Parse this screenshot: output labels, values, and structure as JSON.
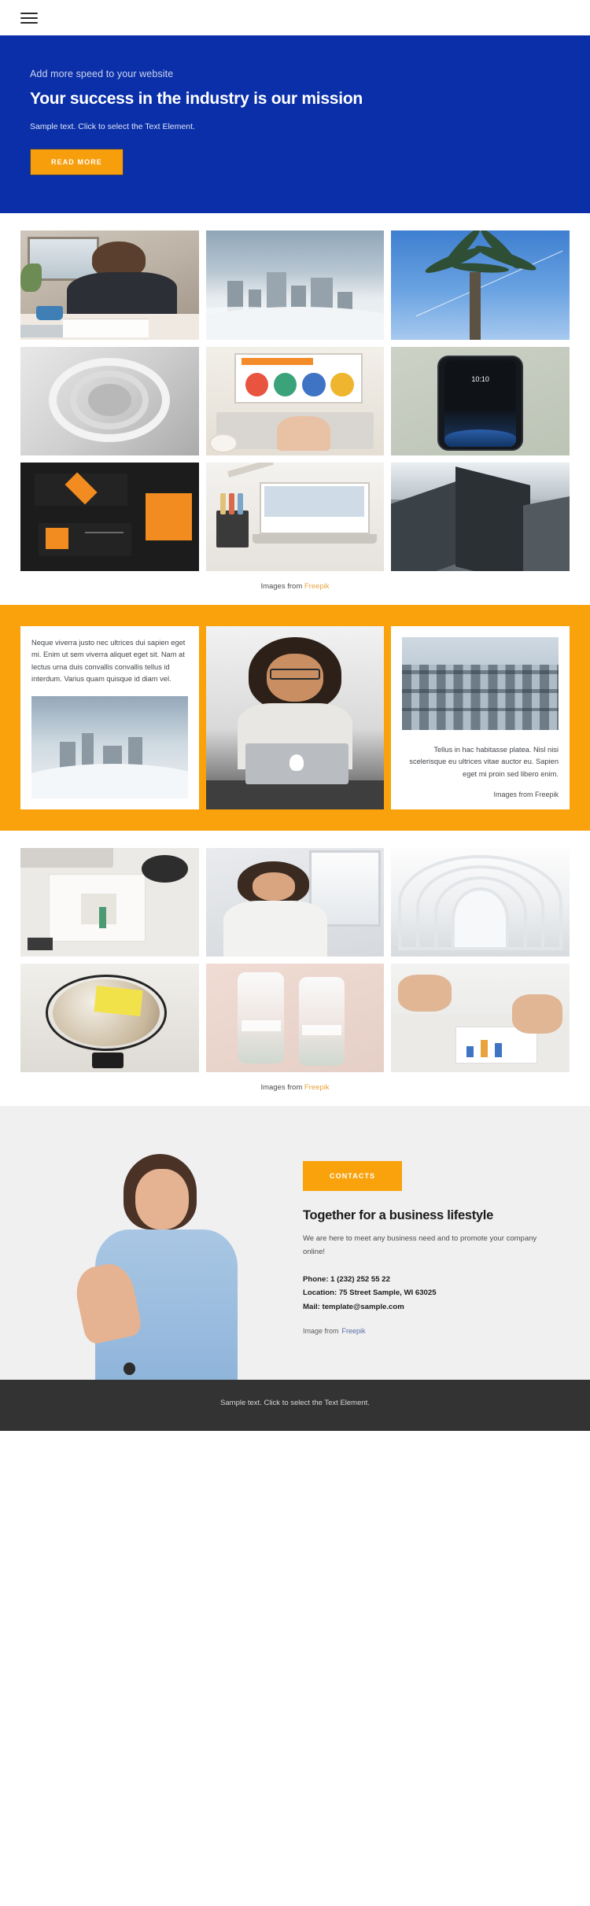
{
  "header": {
    "menu_icon": "hamburger-menu-icon"
  },
  "hero": {
    "eyebrow": "Add more speed to your website",
    "title": "Your success in the industry is our mission",
    "subtitle": "Sample text. Click to select the Text Element.",
    "cta_label": "READ MORE",
    "bg_color": "#0a2fa8",
    "cta_color": "#f79e0c"
  },
  "gallery_top": {
    "caption_prefix": "Images from ",
    "caption_link": "Freepik",
    "tiles": [
      {
        "name": "man-writing-at-desk"
      },
      {
        "name": "city-skyline-in-clouds"
      },
      {
        "name": "palm-tree-blue-sky"
      },
      {
        "name": "white-spiral-architecture"
      },
      {
        "name": "laptop-marketing-strategy"
      },
      {
        "name": "smartphone-on-green"
      },
      {
        "name": "dark-branding-business-cards"
      },
      {
        "name": "desk-pencils-laptop"
      },
      {
        "name": "black-white-skyscrapers"
      }
    ]
  },
  "feature_band": {
    "bg_color": "#f9a20b",
    "card_left": {
      "text": "Neque viverra justo nec ultrices dui sapien eget mi. Enim ut sem viverra aliquet eget sit. Nam at lectus urna duis convallis convallis tellus id interdum. Varius quam quisque id diam vel.",
      "image_name": "city-in-clouds"
    },
    "card_center": {
      "image_name": "smiling-woman-with-laptop"
    },
    "card_right": {
      "image_name": "glass-building-facade",
      "text": "Tellus in hac habitasse platea. Nisl nisi scelerisque eu ultrices vitae auctor eu. Sapien eget mi proin sed libero enim.",
      "credit": "Images from Freepik"
    }
  },
  "gallery_bottom": {
    "caption_prefix": "Images from ",
    "caption_link": "Freepik",
    "tiles": [
      {
        "name": "notebook-and-coffee-flatlay"
      },
      {
        "name": "woman-by-window"
      },
      {
        "name": "white-curved-corridor"
      },
      {
        "name": "globe-with-sticky-note"
      },
      {
        "name": "cosmetic-bottles"
      },
      {
        "name": "business-meeting-charts"
      }
    ]
  },
  "contacts": {
    "badge_label": "CONTACTS",
    "title": "Together for a business lifestyle",
    "description": "We are here to meet any business need and to promote your company online!",
    "phone": "Phone: 1 (232) 252 55 22",
    "location": "Location: 75 Street Sample, WI 63025",
    "mail": "Mail: template@sample.com",
    "credit_prefix": "Image from",
    "credit_link": "Freepik",
    "photo_name": "businesswoman-pointing"
  },
  "footer": {
    "text": "Sample text. Click to select the Text Element."
  }
}
